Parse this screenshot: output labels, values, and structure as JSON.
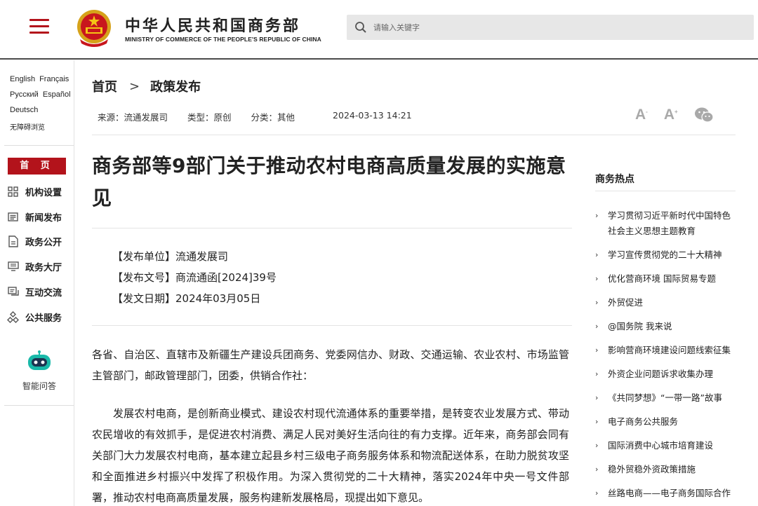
{
  "header": {
    "site_title": "中华人民共和国商务部",
    "site_subtitle": "MINISTRY OF COMMERCE OF THE PEOPLE'S REPUBLIC OF CHINA",
    "search_placeholder": "请输入关键字"
  },
  "languages": {
    "row1": [
      "English",
      "Français"
    ],
    "row2": [
      "Русский",
      "Español"
    ],
    "row3": [
      "Deutsch"
    ],
    "accessibility": "无障碍浏览"
  },
  "sidebar": {
    "home": "首 页",
    "items": [
      {
        "label": "机构设置",
        "icon": "org-grid-icon"
      },
      {
        "label": "新闻发布",
        "icon": "news-icon"
      },
      {
        "label": "政务公开",
        "icon": "document-icon"
      },
      {
        "label": "政务大厅",
        "icon": "hall-icon"
      },
      {
        "label": "互动交流",
        "icon": "chat-icon"
      },
      {
        "label": "公共服务",
        "icon": "service-icon"
      }
    ],
    "bot_label": "智能问答"
  },
  "breadcrumb": {
    "home": "首页",
    "sep": ">",
    "current": "政策发布"
  },
  "meta": {
    "source": "来源：流通发展司",
    "type": "类型：原创",
    "category": "分类：其他",
    "date": "2024-03-13 14:21"
  },
  "tools": {
    "font_small": "A",
    "font_large": "A"
  },
  "article": {
    "title": "商务部等9部门关于推动农村电商高质量发展的实施意见",
    "issuer": "【发布单位】流通发展司",
    "doc_no": "【发布文号】商流通函[2024]39号",
    "issue_date": "【发文日期】2024年03月05日",
    "para1": "各省、自治区、直辖市及新疆生产建设兵团商务、党委网信办、财政、交通运输、农业农村、市场监管主管部门，邮政管理部门，团委，供销合作社：",
    "para2": "发展农村电商，是创新商业模式、建设农村现代流通体系的重要举措，是转变农业发展方式、带动农民增收的有效抓手，是促进农村消费、满足人民对美好生活向往的有力支撑。近年来，商务部会同有关部门大力发展农村电商，基本建立起县乡村三级电子商务服务体系和物流配送体系，在助力脱贫攻坚和全面推进乡村振兴中发挥了积极作用。为深入贯彻党的二十大精神，落实2024年中央一号文件部署，推动农村电商高质量发展，服务构建新发展格局，现提出如下意见。"
  },
  "hot": {
    "title": "商务热点",
    "items": [
      "学习贯彻习近平新时代中国特色社会主义思想主题教育",
      "学习宣传贯彻党的二十大精神",
      "优化营商环境 国际贸易专题",
      "外贸促进",
      "@国务院 我来说",
      "影响营商环境建设问题线索征集",
      "外资企业问题诉求收集办理",
      "《共同梦想》“一带一路”故事",
      "电子商务公共服务",
      "国际消费中心城市培育建设",
      "稳外贸稳外资政策措施",
      "丝路电商——电子商务国际合作"
    ]
  },
  "colors": {
    "brand_red": "#b3131b",
    "icon_gray": "#a9a9a9",
    "bot_teal": "#19b9a9"
  }
}
